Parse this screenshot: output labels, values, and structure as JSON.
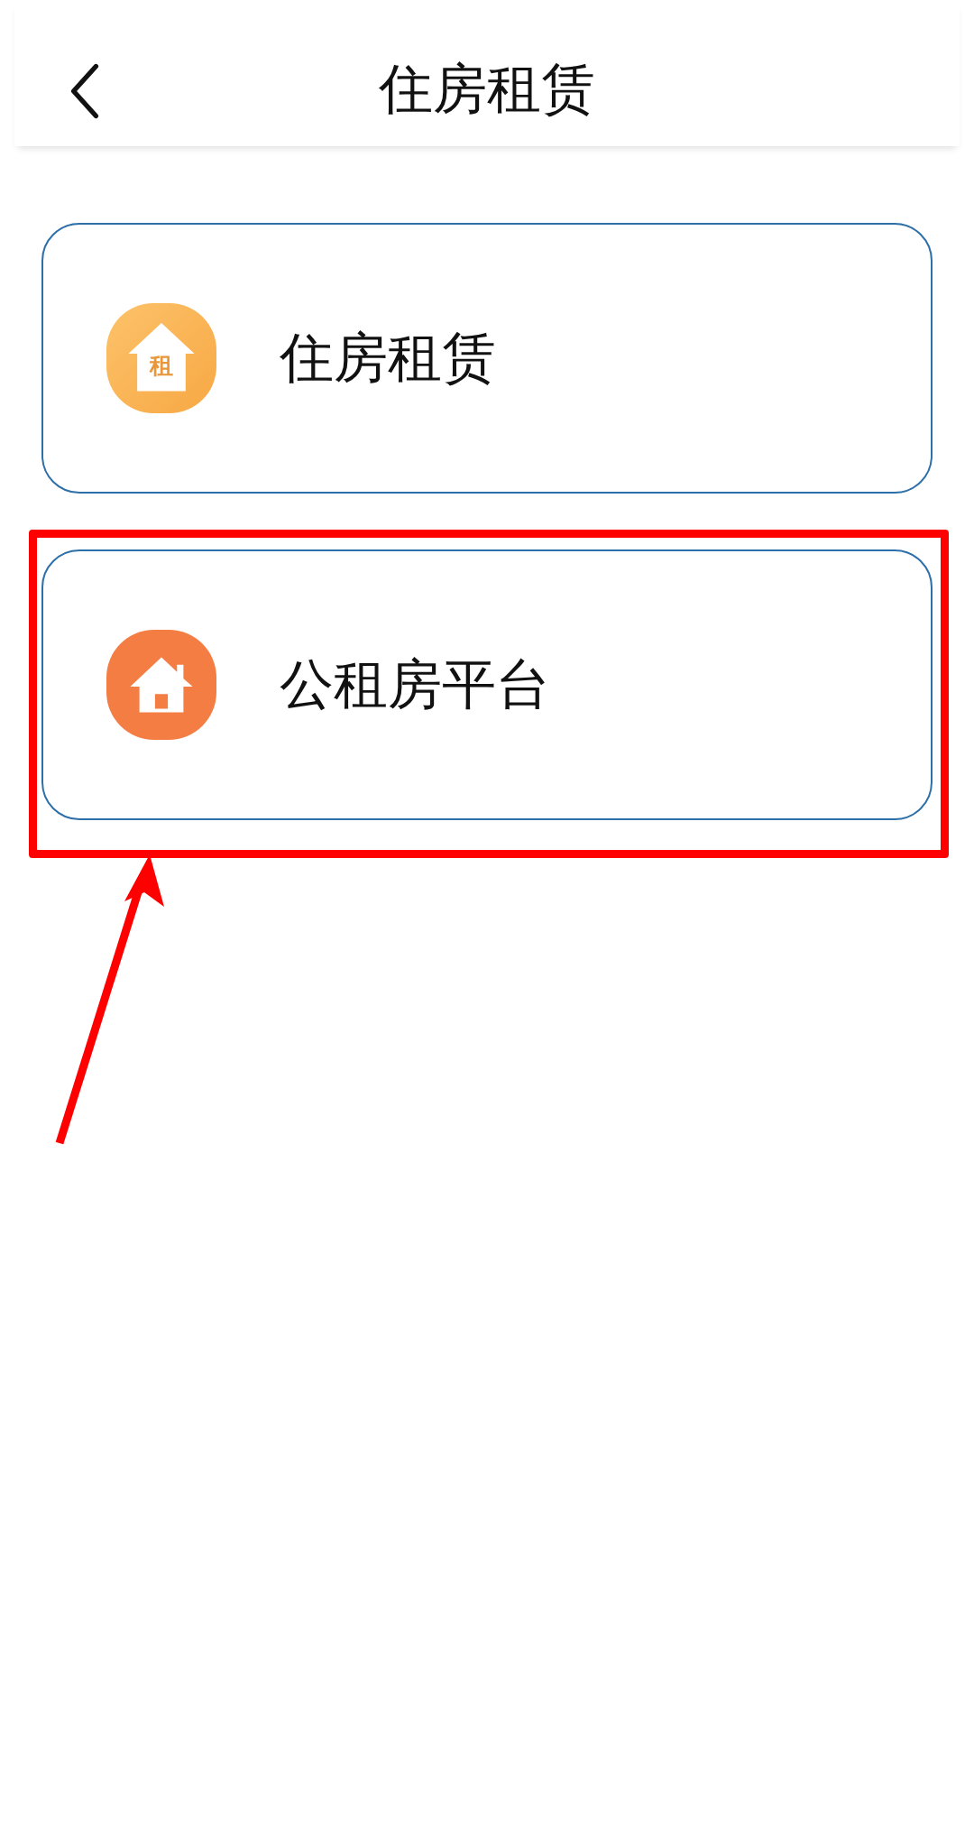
{
  "header": {
    "title": "住房租赁"
  },
  "items": [
    {
      "label": "住房租赁",
      "kind": "rent",
      "glyph": "租",
      "highlighted": false
    },
    {
      "label": "公租房平台",
      "kind": "house",
      "highlighted": true
    }
  ]
}
